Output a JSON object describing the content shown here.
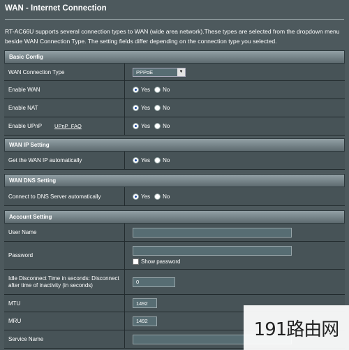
{
  "header": {
    "title": "WAN - Internet Connection",
    "description": "RT-AC66U supports several connection types to WAN (wide area network).These types are selected from the dropdown menu beside WAN Connection Type. The setting fields differ depending on the connection type you selected."
  },
  "basic": {
    "heading": "Basic Config",
    "wan_type_label": "WAN Connection Type",
    "wan_type_value": "PPPoE",
    "enable_wan_label": "Enable WAN",
    "enable_nat_label": "Enable NAT",
    "enable_upnp_label": "Enable UPnP",
    "upnp_faq": "UPnP_FAQ"
  },
  "radio": {
    "yes": "Yes",
    "no": "No"
  },
  "wanip": {
    "heading": "WAN IP Setting",
    "auto_label": "Get the WAN IP automatically"
  },
  "wandns": {
    "heading": "WAN DNS Setting",
    "auto_label": "Connect to DNS Server automatically"
  },
  "account": {
    "heading": "Account Setting",
    "username_label": "User Name",
    "username_value": "",
    "password_label": "Password",
    "password_value": "",
    "show_password": "Show password",
    "idle_label": "Idle Disconnect Time in seconds: Disconnect after time of inactivity (in seconds)",
    "idle_value": "0",
    "mtu_label": "MTU",
    "mtu_value": "1492",
    "mru_label": "MRU",
    "mru_value": "1492",
    "service_label": "Service Name",
    "service_value": ""
  },
  "watermark": "191路由网"
}
